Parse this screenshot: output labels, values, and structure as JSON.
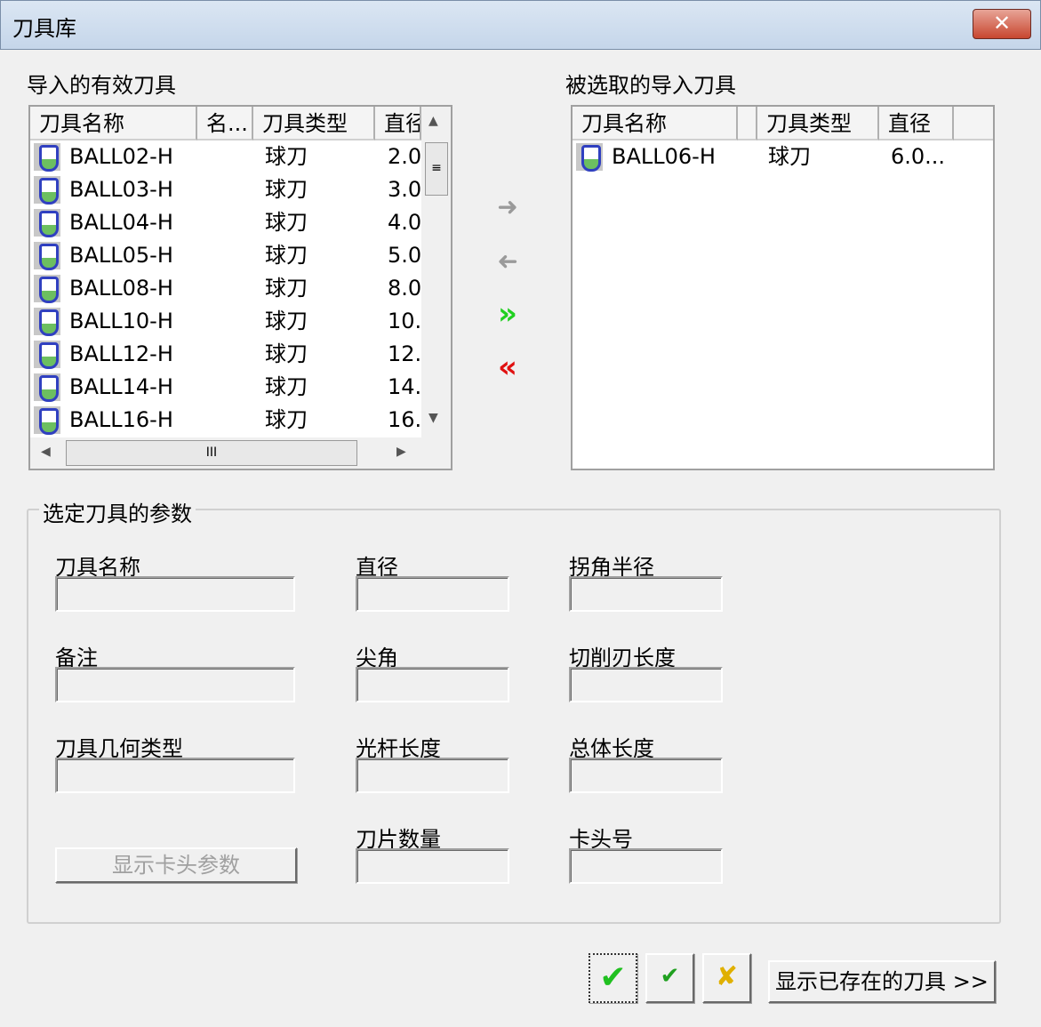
{
  "window": {
    "title": "刀具库",
    "close_label": "✕"
  },
  "left_panel": {
    "title": "导入的有效刀具",
    "columns": [
      "刀具名称",
      "名...",
      "刀具类型",
      "直径"
    ],
    "rows": [
      {
        "name": "BALL02-H",
        "type": "球刀",
        "diameter": "2.0"
      },
      {
        "name": "BALL03-H",
        "type": "球刀",
        "diameter": "3.0"
      },
      {
        "name": "BALL04-H",
        "type": "球刀",
        "diameter": "4.0"
      },
      {
        "name": "BALL05-H",
        "type": "球刀",
        "diameter": "5.0"
      },
      {
        "name": "BALL08-H",
        "type": "球刀",
        "diameter": "8.0"
      },
      {
        "name": "BALL10-H",
        "type": "球刀",
        "diameter": "10."
      },
      {
        "name": "BALL12-H",
        "type": "球刀",
        "diameter": "12."
      },
      {
        "name": "BALL14-H",
        "type": "球刀",
        "diameter": "14."
      },
      {
        "name": "BALL16-H",
        "type": "球刀",
        "diameter": "16."
      }
    ]
  },
  "right_panel": {
    "title": "被选取的导入刀具",
    "columns": [
      "刀具名称",
      "",
      "刀具类型",
      "直径"
    ],
    "rows": [
      {
        "name": "BALL06-H",
        "type": "球刀",
        "diameter": "6.0..."
      }
    ]
  },
  "transfer": {
    "add": "➜",
    "remove": "➜",
    "add_all": "»",
    "remove_all": "«"
  },
  "params": {
    "title": "选定刀具的参数",
    "fields": {
      "tool_name": "刀具名称",
      "diameter": "直径",
      "corner_radius": "拐角半径",
      "note": "备注",
      "tip_angle": "尖角",
      "cut_length": "切削刃长度",
      "geometry_type": "刀具几何类型",
      "shank_length": "光杆长度",
      "total_length": "总体长度",
      "flute_count": "刀片数量",
      "holder_no": "卡头号"
    },
    "show_holder_button": "显示卡头参数"
  },
  "footer": {
    "show_existing_button": "显示已存在的刀具 >>",
    "ok": "✔",
    "apply": "✔",
    "cancel": "✘"
  },
  "scroll": {
    "thumb": "III"
  }
}
